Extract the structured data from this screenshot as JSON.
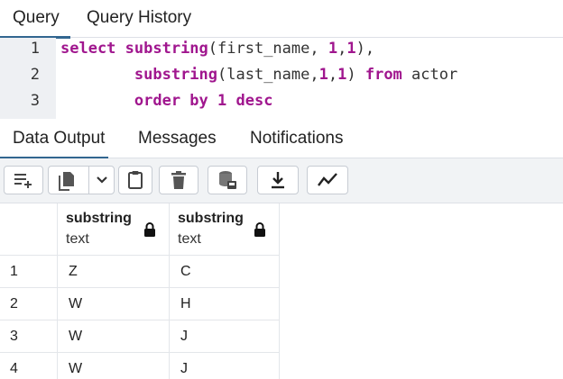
{
  "query_tabs": {
    "query": "Query",
    "history": "Query History"
  },
  "editor": {
    "lines": [
      {
        "num": "1",
        "parts": [
          {
            "t": "select",
            "c": "kw"
          },
          {
            "t": " substring",
            "c": "kw"
          },
          {
            "t": "(first_name, ",
            "c": "plain"
          },
          {
            "t": "1",
            "c": "num"
          },
          {
            "t": ",",
            "c": "plain"
          },
          {
            "t": "1",
            "c": "num"
          },
          {
            "t": "),",
            "c": "plain"
          }
        ]
      },
      {
        "num": "2",
        "parts": [
          {
            "t": "        ",
            "c": "plain"
          },
          {
            "t": "substring",
            "c": "kw"
          },
          {
            "t": "(last_name,",
            "c": "plain"
          },
          {
            "t": "1",
            "c": "num"
          },
          {
            "t": ",",
            "c": "plain"
          },
          {
            "t": "1",
            "c": "num"
          },
          {
            "t": ") ",
            "c": "plain"
          },
          {
            "t": "from",
            "c": "kw"
          },
          {
            "t": " actor",
            "c": "plain"
          }
        ]
      },
      {
        "num": "3",
        "parts": [
          {
            "t": "        ",
            "c": "plain"
          },
          {
            "t": "order by",
            "c": "kw"
          },
          {
            "t": " ",
            "c": "plain"
          },
          {
            "t": "1",
            "c": "num"
          },
          {
            "t": " ",
            "c": "plain"
          },
          {
            "t": "desc",
            "c": "kw"
          }
        ]
      }
    ]
  },
  "output_tabs": {
    "data_output": "Data Output",
    "messages": "Messages",
    "notifications": "Notifications"
  },
  "toolbar": {
    "icons": [
      "add-row-icon",
      "copy-icon",
      "chevron-down-icon",
      "paste-icon",
      "delete-icon",
      "save-data-icon",
      "download-icon",
      "graph-icon"
    ]
  },
  "grid": {
    "columns": [
      {
        "name": "substring",
        "type": "text"
      },
      {
        "name": "substring",
        "type": "text"
      }
    ],
    "rows": [
      {
        "num": "1",
        "cells": [
          "Z",
          "C"
        ]
      },
      {
        "num": "2",
        "cells": [
          "W",
          "H"
        ]
      },
      {
        "num": "3",
        "cells": [
          "W",
          "J"
        ]
      },
      {
        "num": "4",
        "cells": [
          "W",
          "J"
        ]
      }
    ]
  },
  "colors": {
    "active_tab": "#326690",
    "keyword": "#a0168e"
  }
}
